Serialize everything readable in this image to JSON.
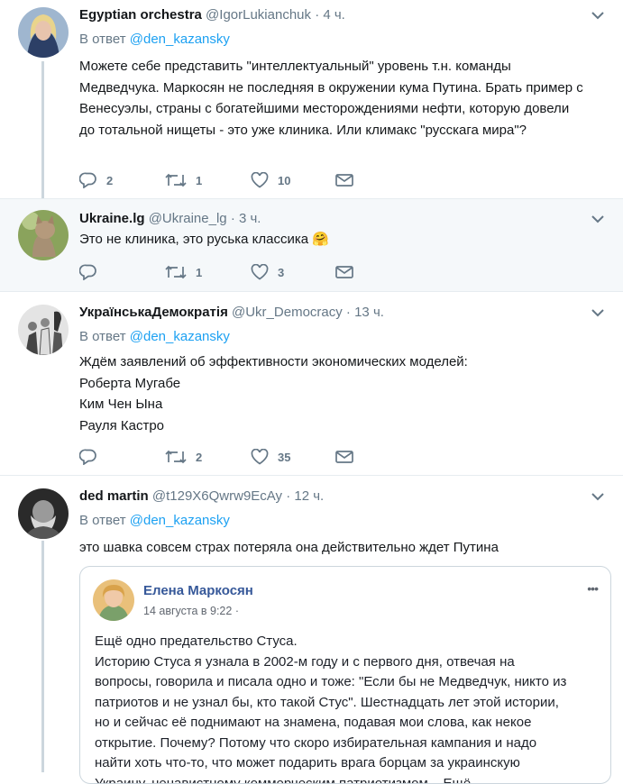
{
  "reply_prefix": "В ответ",
  "tweets": [
    {
      "name": "Egyptian orchestra",
      "handle": "@IgorLukianchuk",
      "dot": "·",
      "time": "4 ч.",
      "reply_to": "@den_kazansky",
      "text": "Можете себе представить \"интеллектуальный\" уровень т.н. команды Медведчука. Маркосян не последняя в окружении кума Путина. Брать пример с Венесуэлы, страны с богатейшими месторождениями нефти, которую довели до тотальной нищеты - это уже клиника. Или климакс \"русскага мира\"?",
      "replies": "2",
      "retweets": "1",
      "likes": "10"
    },
    {
      "name": "Ukraine.lg",
      "handle": "@Ukraine_lg",
      "dot": "·",
      "time": "3 ч.",
      "text": "Это не клиника, это руська классика",
      "emoji": "🤗",
      "replies": "",
      "retweets": "1",
      "likes": "3"
    },
    {
      "name": "УкраїнськаДемократія",
      "handle": "@Ukr_Democracy",
      "dot": "·",
      "time": "13 ч.",
      "reply_to": "@den_kazansky",
      "lines": [
        "Ждём заявлений об эффективности экономических моделей:",
        "Роберта Мугабе",
        "Ким Чен Ына",
        "Рауля Кастро"
      ],
      "replies": "",
      "retweets": "2",
      "likes": "35"
    },
    {
      "name": "ded martin",
      "handle": "@t129X6Qwrw9EcAy",
      "dot": "·",
      "time": "12 ч.",
      "reply_to": "@den_kazansky",
      "text": "это шавка совсем страх потеряла она действительно ждет Путина"
    }
  ],
  "embed": {
    "author": "Елена Маркосян",
    "date": "14 августа в 9:22 ·",
    "menu": "•••",
    "text": "Ещё одно предательство Стуса.\nИсторию Стуса я узнала в 2002-м году и с первого дня, отвечая на вопросы, говорила и писала одно и тоже: \"Если бы не Медведчук, никто из патриотов и не узнал бы, кто такой Стус\". Шестнадцать лет этой истории, но и сейчас её поднимают на знамена, подавая мои слова, как некое открытие. Почему? Потому что скоро избирательная кампания и надо найти хоть что-то, что может подарить врага борцам за украинскую Украину, ненавистному коммерческим патриотизмом... Ещё"
  },
  "colors": {
    "accent": "#1da1f2",
    "secondary_text": "#657786",
    "highlight_bg": "#f5f8fa",
    "border": "#e6ecf0",
    "fb_blue": "#365899"
  },
  "icons": [
    "chevron-down-icon",
    "reply-icon",
    "retweet-icon",
    "like-icon",
    "message-icon",
    "more-icon"
  ]
}
